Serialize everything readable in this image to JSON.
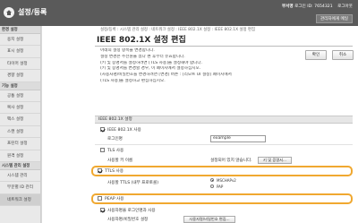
{
  "header": {
    "title": "설정/등록",
    "department_label": "부서명",
    "login_id_label": "로그인 ID:",
    "login_id": "7654321",
    "logout": "로그아웃",
    "admin_link": "관리자에게 메일"
  },
  "sidebar": {
    "sections": [
      {
        "heading": "환경 설정",
        "items": [
          "용지 설정",
          "표시 설정",
          "타이머 설정",
          "경향 설정"
        ]
      },
      {
        "heading": "기능 설정",
        "items": [
          "공통 설정",
          "복사 설정",
          "팩스 설정",
          "스캔 설정",
          "프린터 설정",
          "원격 설정"
        ]
      },
      {
        "heading": "시스템 관리 설정",
        "items": [
          "시스템 관리",
          "부문별 ID 관리",
          "네트워크 설정"
        ]
      }
    ]
  },
  "breadcrumb": "설정/등록 : 시스템 관리 설정 : 네트워크 설정 : IEEE 802.1X 설정 : IEEE 802.1X 설정 편집",
  "page_title": "IEEE 802.1X 설정 편집",
  "description": [
    "아래의 설정 항목을 변경합니다.",
    "설정 변경은 주전원을 껐다 켠 후부터 유효합니다.",
    "(키 및 증명서를 설정하려면 [TLS 사용]을 설정해야 합니다.",
    "(키 및 증명서를 변경할 경우, 이 페이지에서 설정하십시오.",
    "(사용자명/비밀번호를 변경하려면 [변경] 버튼 : [리모트 UI 설정] 페이지에서",
    "(TLS 사용]을 설정하고 편집하십시오."
  ],
  "buttons": {
    "ok": "확인",
    "cancel": "취소"
  },
  "section": {
    "heading": "IEEE 802.1X 설정",
    "use_ieee": "IEEE 802.1X 사용",
    "login_name_label": "로그인명",
    "login_name_value": "example",
    "tls_use": "TLS 사용",
    "key_cert_label": "사용할 키 이름",
    "key_cert_value": "설정되어 있지 않습니다.",
    "key_cert_button": "키 및 증명서...",
    "ttls_use": "TTLS 사용",
    "ttls_inner_label": "사용할 TTLS (내부 프로토콜)",
    "ttls_options": [
      "MSCHAPv2",
      "PAP"
    ],
    "peap_use": "PEAP 사용",
    "auth_user_label": "사용자명을 로그인명과 사용",
    "user_pw_label": "사용자명/비밀번호 설정",
    "user_pw_button": "사용자명/비밀번호 편집..."
  }
}
